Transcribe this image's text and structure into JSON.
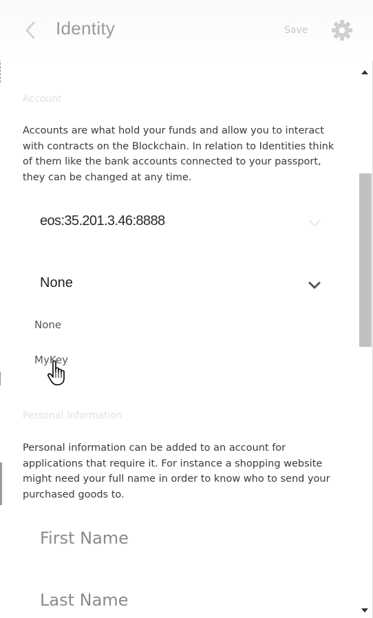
{
  "header": {
    "title": "Identity",
    "save_label": "Save",
    "back_icon": "chevron-left-icon",
    "settings_icon": "gear-icon"
  },
  "account": {
    "section_label": "Account",
    "description": "Accounts are what hold your funds and allow you to interact with contracts on the Blockchain. In relation to Identities think of them like the bank accounts connected to your passport, they can be changed at any time.",
    "network_select_value": "eos:35.201.3.46:8888",
    "account_select_value": "None",
    "dropdown_options": [
      "None",
      "MyKey"
    ]
  },
  "personal": {
    "section_label": "Personal Information",
    "description": "Personal information can be added to an account for applications that require it. For instance a shopping website might need your full name in order to know who to send your purchased goods to.",
    "first_name_placeholder": "First Name",
    "last_name_placeholder": "Last Name"
  },
  "colors": {
    "title": "#9a9a9a",
    "section_label": "#e1e1e1",
    "body_text": "#3a3a3a",
    "scroll_thumb": "#c1c1c1"
  }
}
